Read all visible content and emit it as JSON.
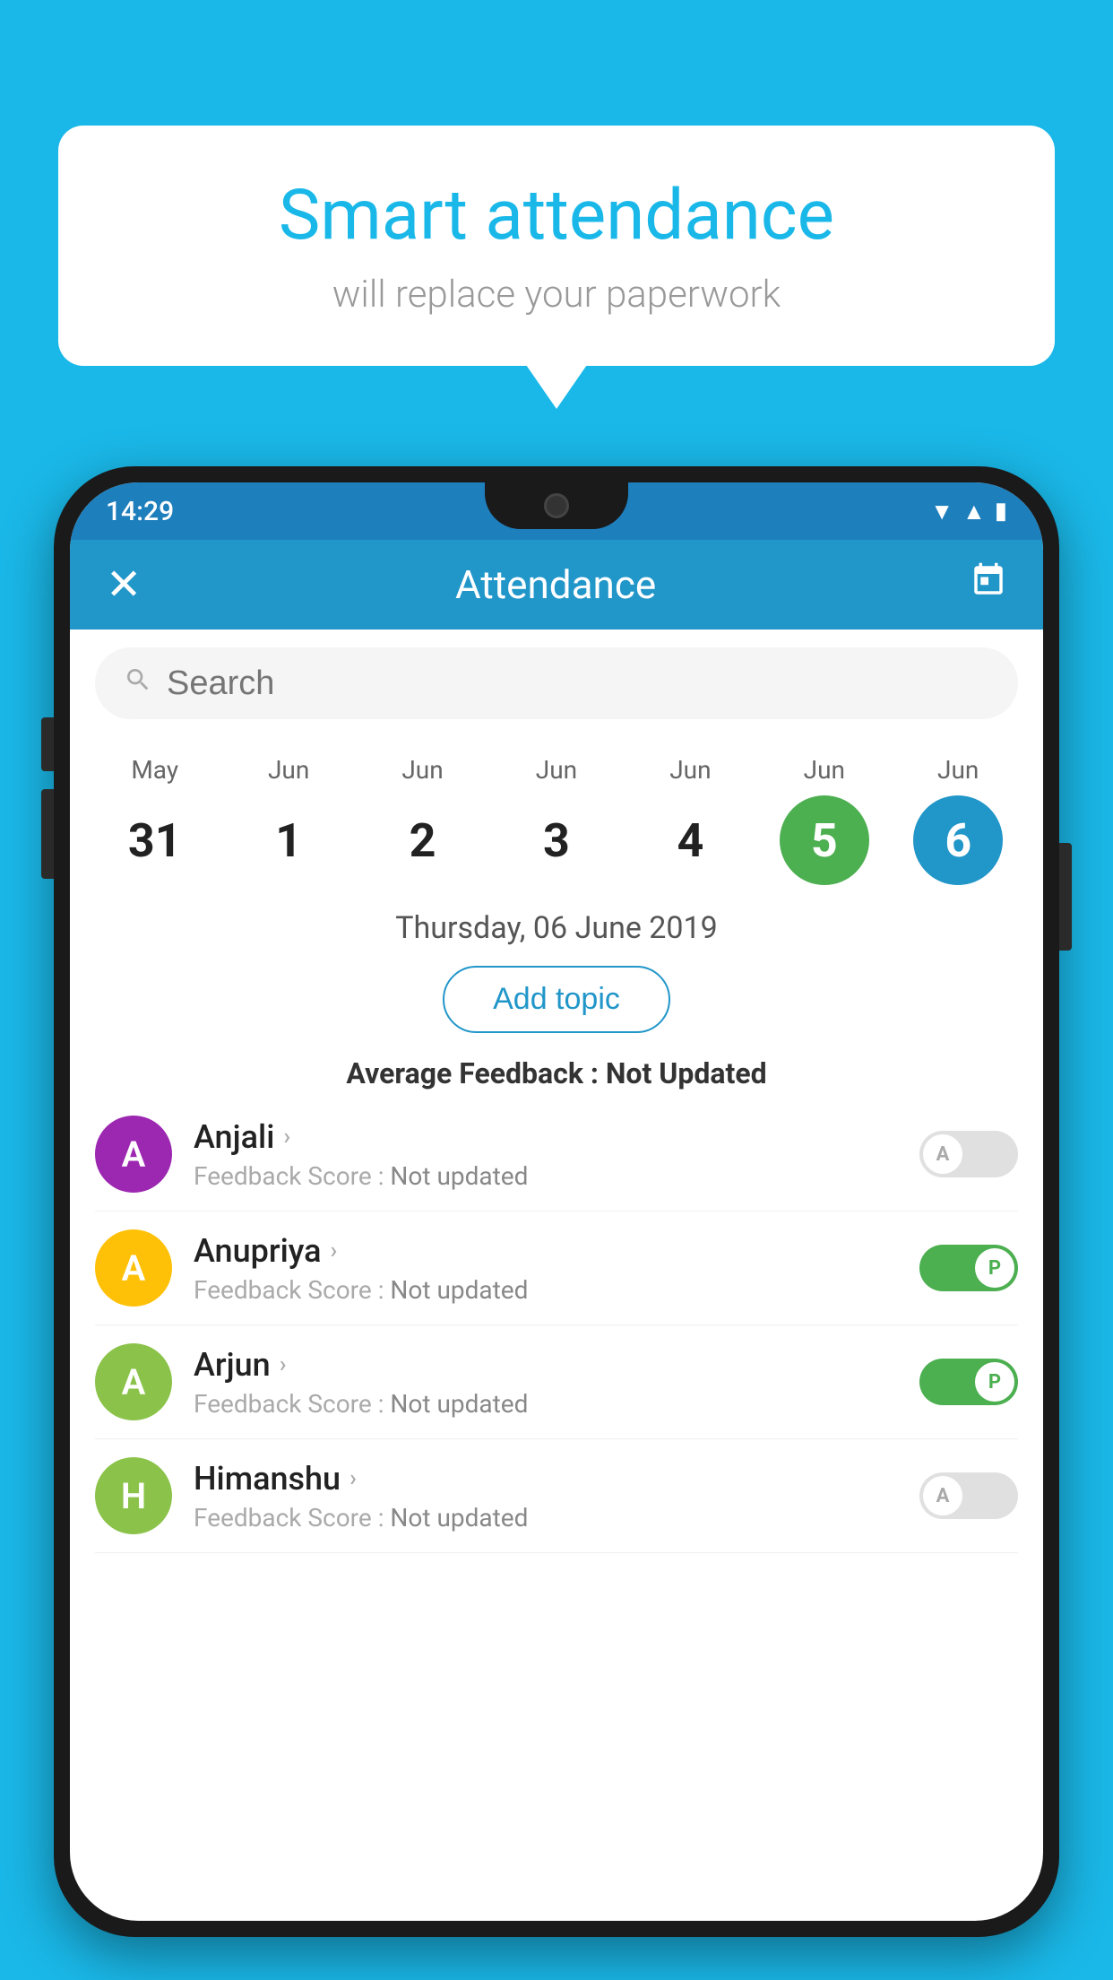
{
  "background_color": "#1ab8e8",
  "speech_bubble": {
    "title": "Smart attendance",
    "subtitle": "will replace your paperwork"
  },
  "status_bar": {
    "time": "14:29",
    "wifi": "▼",
    "signal": "▲",
    "battery": "▮"
  },
  "header": {
    "close_icon": "✕",
    "title": "Attendance",
    "calendar_icon": "📅"
  },
  "search": {
    "placeholder": "Search"
  },
  "calendar": {
    "days": [
      {
        "month": "May",
        "day": "31",
        "style": "normal"
      },
      {
        "month": "Jun",
        "day": "1",
        "style": "normal"
      },
      {
        "month": "Jun",
        "day": "2",
        "style": "normal"
      },
      {
        "month": "Jun",
        "day": "3",
        "style": "normal"
      },
      {
        "month": "Jun",
        "day": "4",
        "style": "normal"
      },
      {
        "month": "Jun",
        "day": "5",
        "style": "today"
      },
      {
        "month": "Jun",
        "day": "6",
        "style": "selected"
      }
    ]
  },
  "selected_date": "Thursday, 06 June 2019",
  "add_topic_label": "Add topic",
  "average_feedback": {
    "label": "Average Feedback : ",
    "value": "Not Updated"
  },
  "students": [
    {
      "name": "Anjali",
      "avatar_letter": "A",
      "avatar_color": "#9c27b0",
      "feedback_label": "Feedback Score : ",
      "feedback_value": "Not updated",
      "toggle": "off",
      "toggle_label": "A"
    },
    {
      "name": "Anupriya",
      "avatar_letter": "A",
      "avatar_color": "#ffc107",
      "feedback_label": "Feedback Score : ",
      "feedback_value": "Not updated",
      "toggle": "on",
      "toggle_label": "P"
    },
    {
      "name": "Arjun",
      "avatar_letter": "A",
      "avatar_color": "#8bc34a",
      "feedback_label": "Feedback Score : ",
      "feedback_value": "Not updated",
      "toggle": "on",
      "toggle_label": "P"
    },
    {
      "name": "Himanshu",
      "avatar_letter": "H",
      "avatar_color": "#8bc34a",
      "feedback_label": "Feedback Score : ",
      "feedback_value": "Not updated",
      "toggle": "off",
      "toggle_label": "A"
    }
  ]
}
